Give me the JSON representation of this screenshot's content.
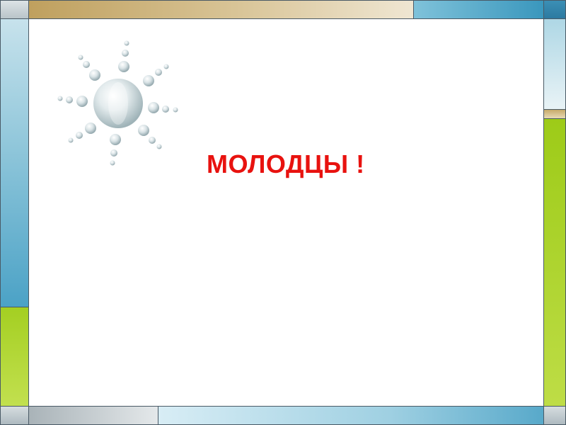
{
  "slide": {
    "message": "МОЛОДЦЫ !",
    "message_color": "#e8120f",
    "decoration": "sun-bubbles-icon"
  },
  "colors": {
    "frame_tan": "#cbb074",
    "frame_blue": "#4ba2c6",
    "frame_green": "#a4cf22",
    "frame_gray": "#c3ccd0",
    "background": "#ffffff"
  }
}
